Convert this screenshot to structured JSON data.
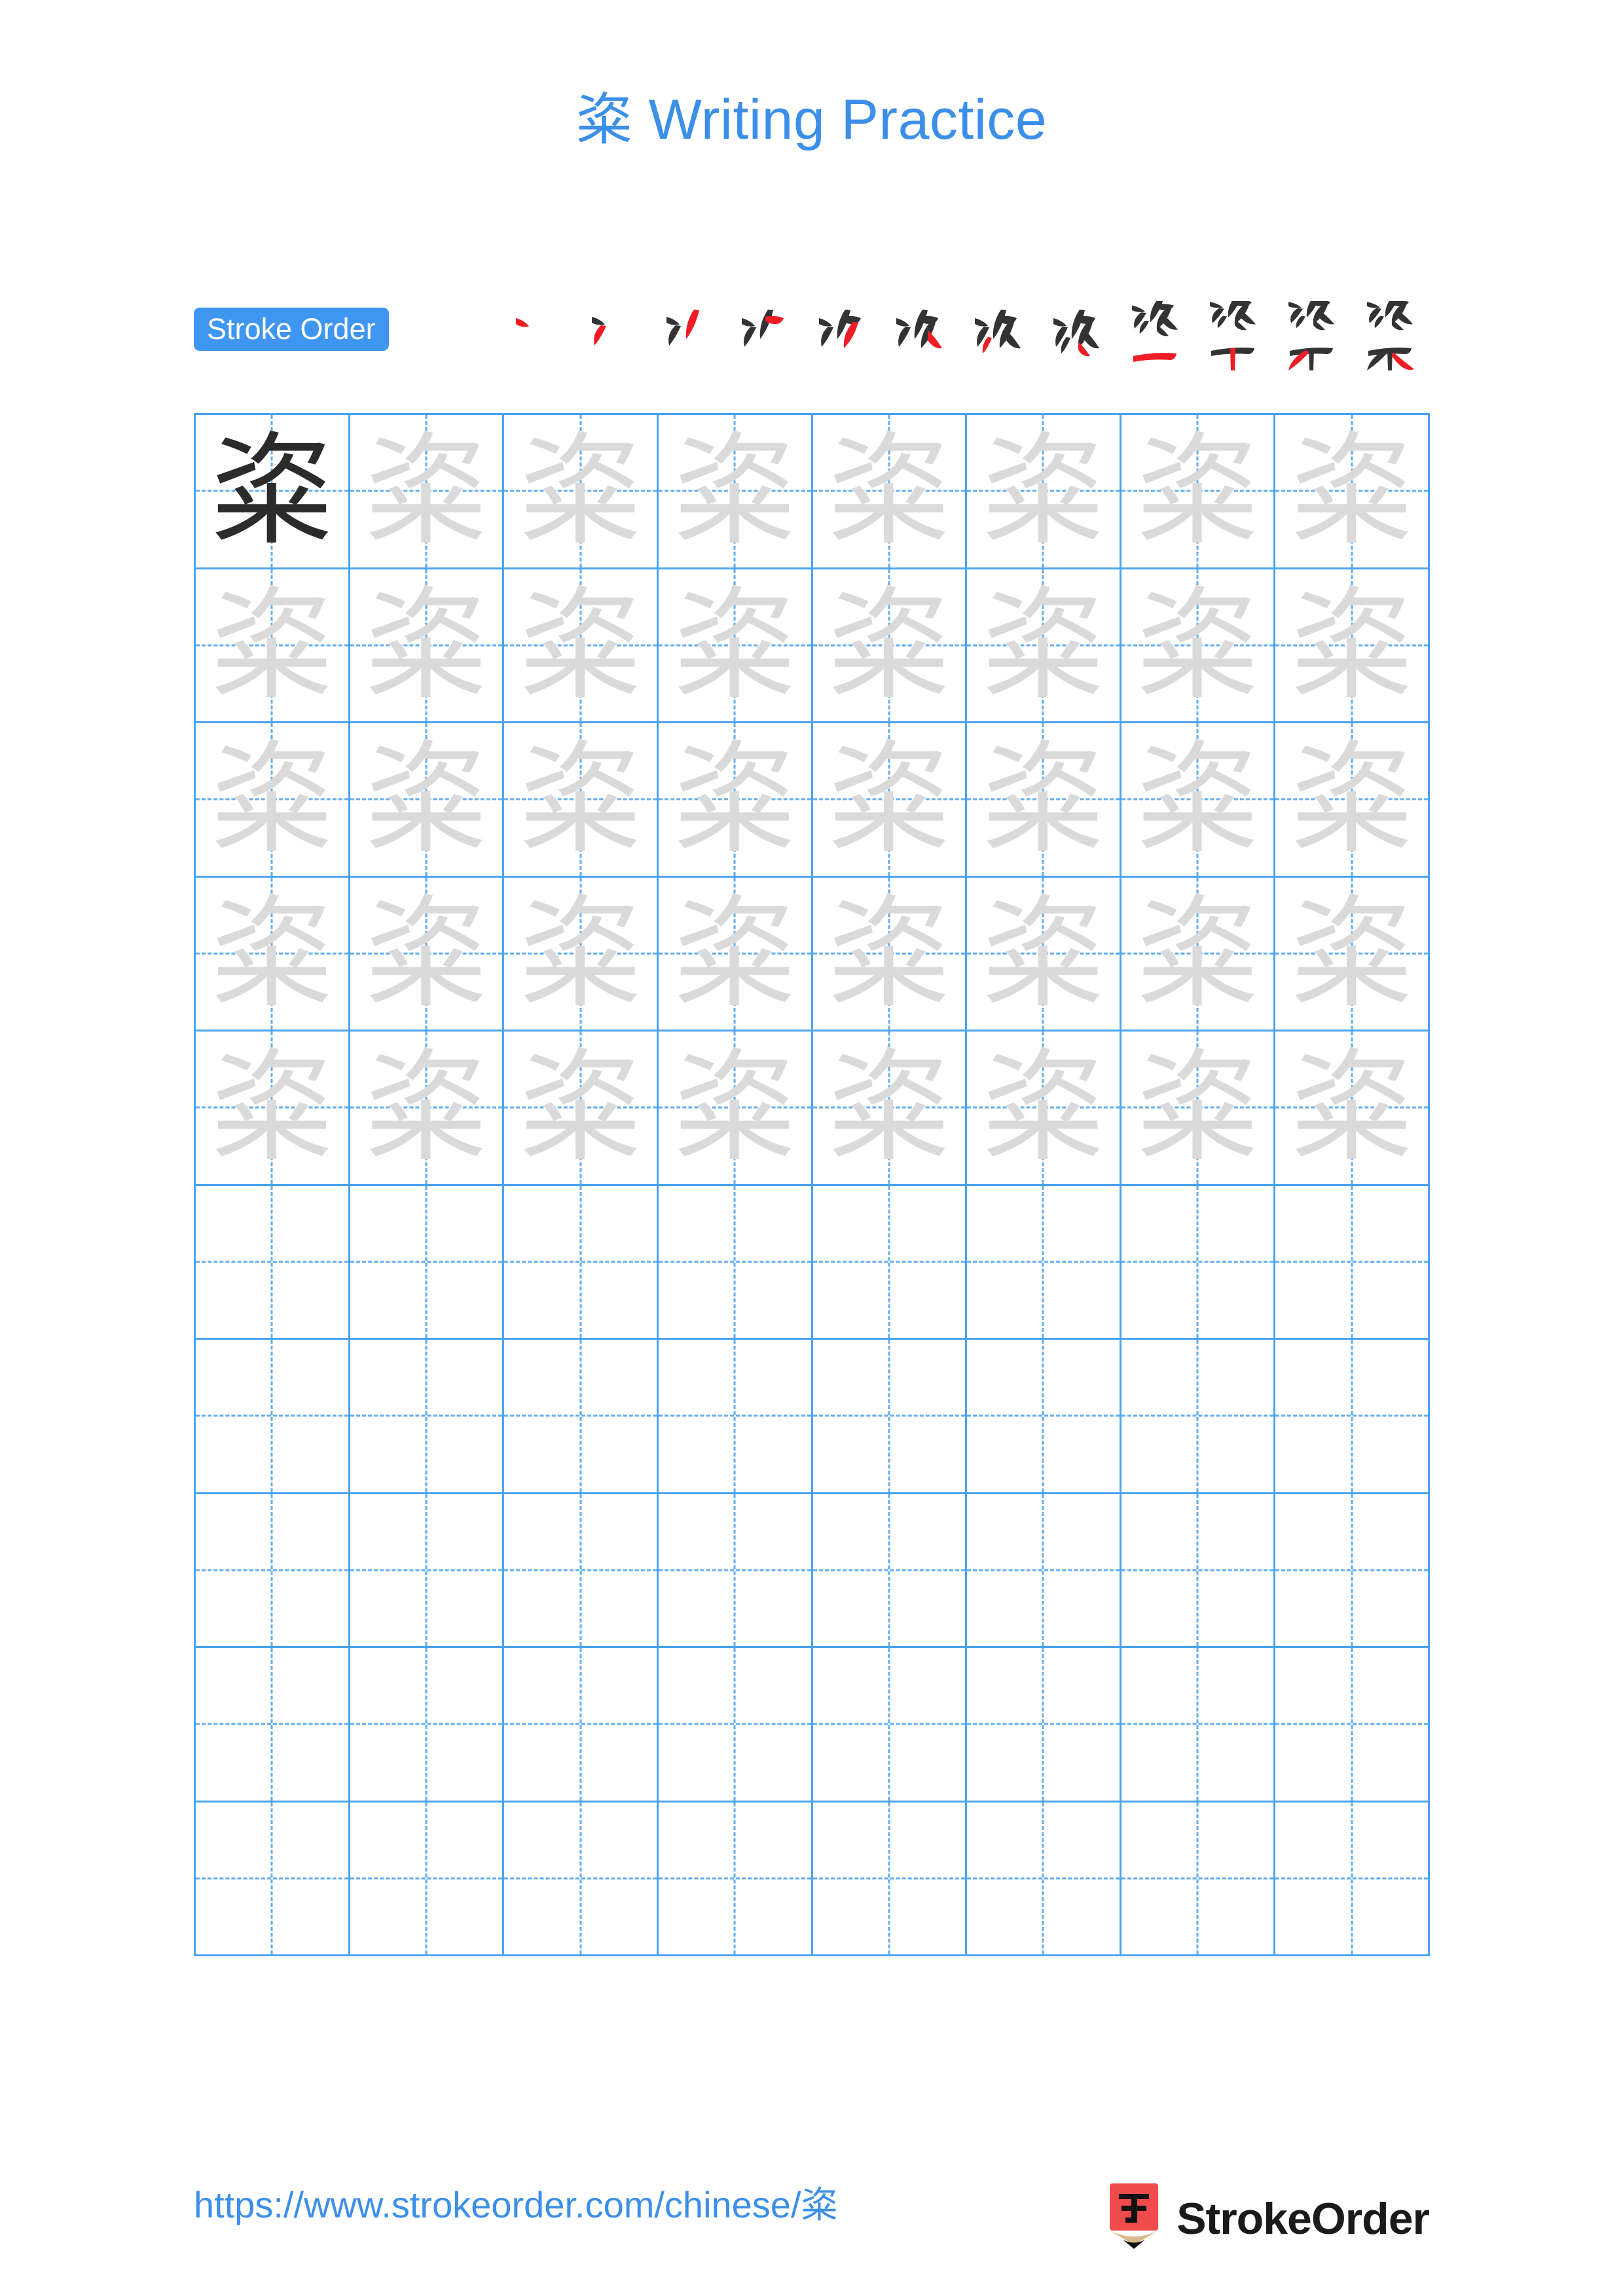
{
  "page": {
    "character": "粢",
    "title": "粢 Writing Practice",
    "title_prefix_char": "粢",
    "title_suffix": " Writing Practice",
    "background_color": "#ffffff",
    "accent_color": "#3b8fe8",
    "grid_line_color": "#4aa3f0",
    "guide_line_color": "#62adf2",
    "new_stroke_color": "#ee1c25",
    "existing_stroke_color": "#333333",
    "trace_ink_color": "#dadada",
    "reference_ink_color": "#2b2b2b"
  },
  "stroke_order": {
    "badge_label": "Stroke Order",
    "total_strokes": 12,
    "steps": [
      {
        "index": 1,
        "cumulative_character": "丶",
        "new_stroke": "dot"
      },
      {
        "index": 2,
        "cumulative_character": "冫",
        "new_stroke": "dot"
      },
      {
        "index": 3,
        "cumulative_character": "丬",
        "new_stroke": "downward-left"
      },
      {
        "index": 4,
        "cumulative_character": "产",
        "new_stroke": "horizontal-hook"
      },
      {
        "index": 5,
        "cumulative_character": "沙",
        "new_stroke": "downward-left"
      },
      {
        "index": 6,
        "cumulative_character": "次",
        "new_stroke": "right-falling"
      },
      {
        "index": 7,
        "cumulative_character": "次",
        "new_stroke": "left-falling"
      },
      {
        "index": 8,
        "cumulative_character": "次",
        "new_stroke": "right-falling"
      },
      {
        "index": 9,
        "cumulative_character": "坐",
        "new_stroke": "horizontal"
      },
      {
        "index": 10,
        "cumulative_character": "竿",
        "new_stroke": "vertical"
      },
      {
        "index": 11,
        "cumulative_character": "粢",
        "new_stroke": "left-falling"
      },
      {
        "index": 12,
        "cumulative_character": "粢",
        "new_stroke": "right-falling"
      }
    ]
  },
  "grid": {
    "columns": 8,
    "rows": 10,
    "reference_cell": {
      "row": 1,
      "column": 1
    },
    "traced_rows": 5,
    "empty_rows": 5,
    "character": "粢"
  },
  "footer": {
    "url": "https://www.strokeorder.com/chinese/粢",
    "brand_name": "StrokeOrder",
    "logo_char": "字",
    "logo_body_color": "#ef4b4b",
    "logo_wood_color": "#dbb98a",
    "logo_tip_color": "#111111"
  }
}
